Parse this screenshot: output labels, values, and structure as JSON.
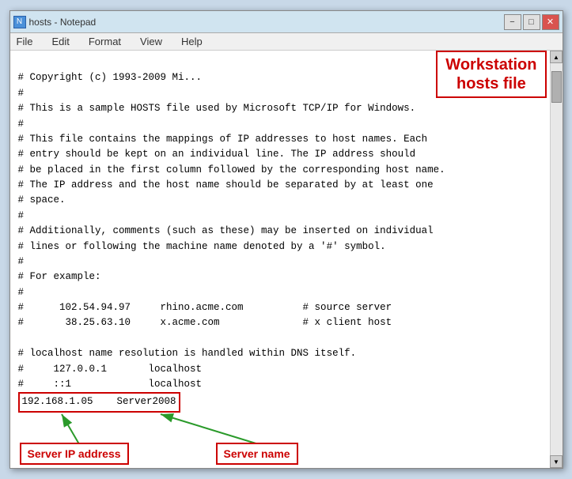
{
  "window": {
    "title": "hosts - Notepad",
    "icon": "📄"
  },
  "title_bar_buttons": {
    "minimize": "−",
    "maximize": "□",
    "close": "✕"
  },
  "menu": {
    "items": [
      "File",
      "Edit",
      "Format",
      "View",
      "Help"
    ]
  },
  "annotation": {
    "title_label": "Workstation\nhosts file",
    "ip_label": "Server IP address",
    "name_label": "Server name"
  },
  "hosts_content": {
    "line1": "# Copyright (c) 1993-2009 Mi...",
    "line2": "#",
    "line3": "# This is a sample HOSTS file used by Microsoft TCP/IP for Windows.",
    "line4": "#",
    "line5": "# This file contains the mappings of IP addresses to host names. Each",
    "line6": "# entry should be kept on an individual line. The IP address should",
    "line7": "# be placed in the first column followed by the corresponding host name.",
    "line8": "# The IP address and the host name should be separated by at least one",
    "line9": "# space.",
    "line10": "#",
    "line11": "# Additionally, comments (such as these) may be inserted on individual",
    "line12": "# lines or following the machine name denoted by a '#' symbol.",
    "line13": "#",
    "line14": "# For example:",
    "line15": "#",
    "line16": "#      102.54.94.97     rhino.acme.com          # source server",
    "line17": "#       38.25.63.10     x.acme.com              # x client host",
    "line18": "",
    "line19": "# localhost name resolution is handled within DNS itself.",
    "line20": "#     127.0.0.1       localhost",
    "line21": "#     ::1             localhost",
    "entry_ip": "192.168.1.05",
    "entry_name": "Server2008"
  }
}
